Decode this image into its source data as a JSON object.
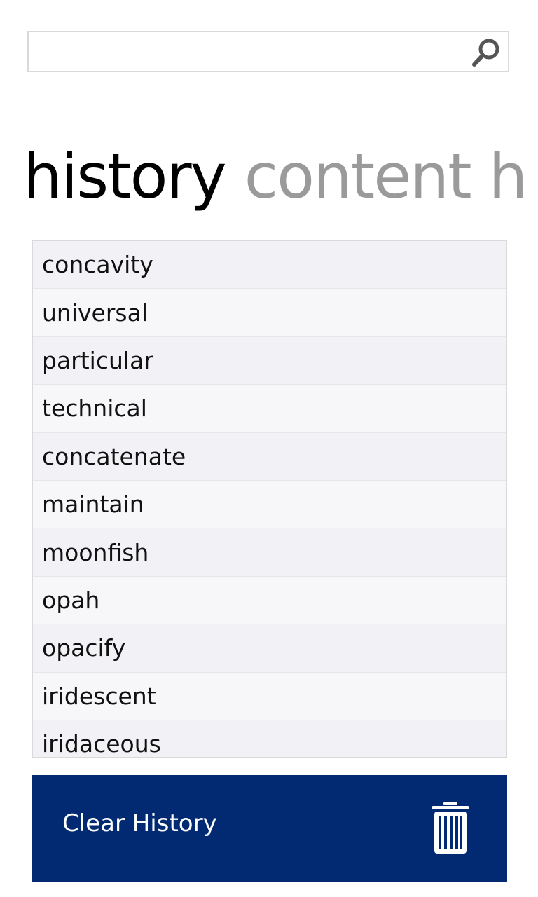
{
  "search": {
    "value": "",
    "placeholder": "",
    "icon": "search-icon"
  },
  "pivot": {
    "tabs": [
      {
        "label": "history"
      },
      {
        "label": "content h"
      }
    ]
  },
  "history": {
    "items": [
      "concavity",
      "universal",
      "particular",
      "technical",
      "concatenate",
      "maintain",
      "moonfish",
      "opah",
      "opacify",
      "iridescent",
      "iridaceous"
    ]
  },
  "clear_bar": {
    "label": "Clear History",
    "icon": "trash-icon",
    "color": "#012a72"
  }
}
